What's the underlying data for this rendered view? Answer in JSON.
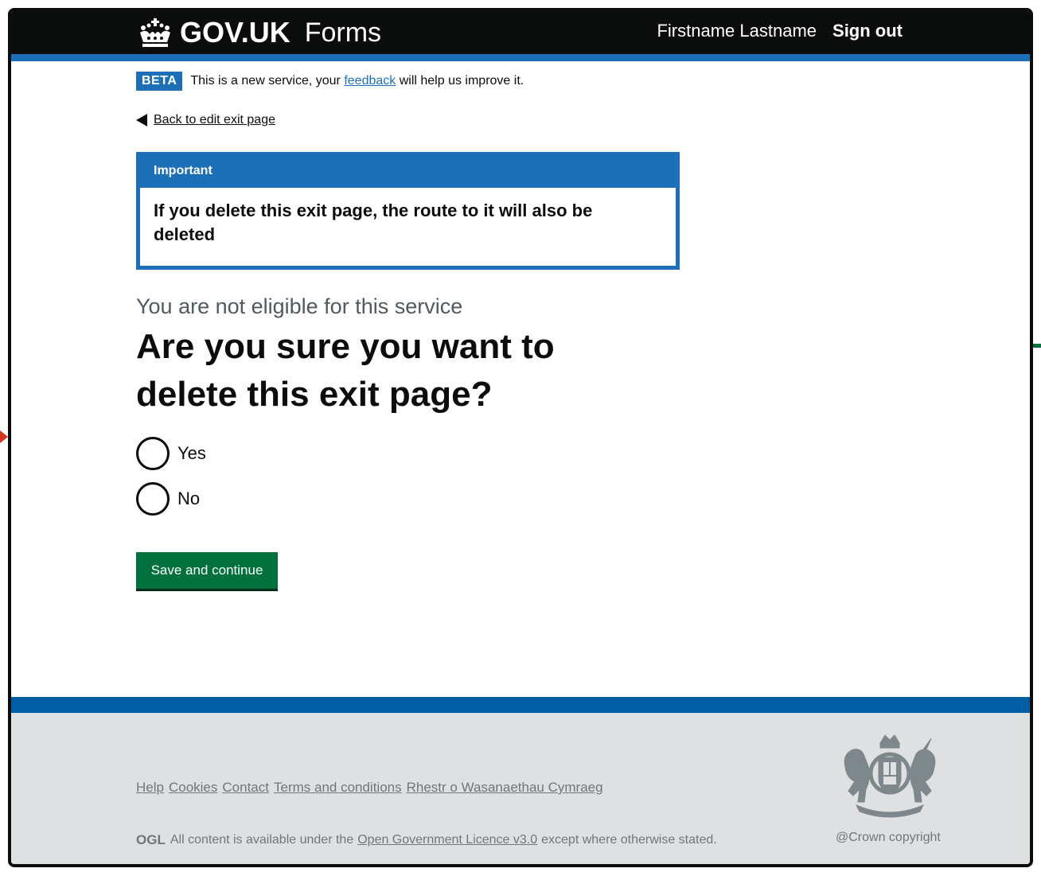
{
  "header": {
    "logo_text": "GOV.UK",
    "product_name": "Forms",
    "user_name": "Firstname Lastname",
    "sign_out": "Sign out",
    "logo_icon": "crown-icon"
  },
  "phase_banner": {
    "tag": "BETA",
    "text_before": "This is a new service, your ",
    "link": "feedback",
    "text_after": " will help us improve it."
  },
  "back_link": "Back to edit exit page",
  "notification": {
    "title": "Important",
    "body": "If you delete this exit page, the route to it will also be deleted"
  },
  "form": {
    "caption": "You are not eligible for this service",
    "heading": "Are you sure you want to delete this exit page?",
    "options": [
      "Yes",
      "No"
    ],
    "submit": "Save and continue"
  },
  "footer": {
    "links": [
      "Help",
      "Cookies",
      "Contact",
      "Terms and conditions",
      "Rhestr o Wasanaethau Cymraeg"
    ],
    "ogl": "OGL",
    "licence_before": "All content is available under the",
    "licence_link": "Open Government Licence v3.0",
    "licence_after": "except where otherwise stated.",
    "copyright": "@Crown copyright",
    "crest_icon": "royal-crest-icon"
  },
  "colors": {
    "header": "#0b0c0c",
    "brand_blue": "#1d70b8",
    "button_green": "#00703c",
    "footer_bg": "#dee0e2",
    "footer_stripe": "#005ea5"
  }
}
